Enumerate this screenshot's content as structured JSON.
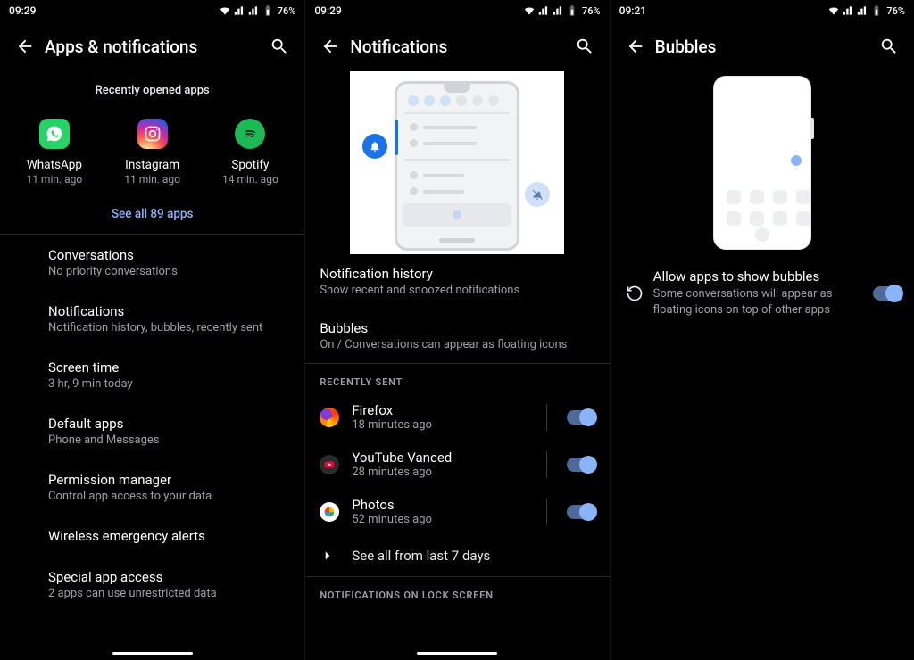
{
  "screen1": {
    "status": {
      "time": "09:29",
      "battery": "76%"
    },
    "header": {
      "title": "Apps & notifications"
    },
    "recently_opened_label": "Recently opened apps",
    "apps": [
      {
        "name": "WhatsApp",
        "sub": "11 min. ago"
      },
      {
        "name": "Instagram",
        "sub": "11 min. ago"
      },
      {
        "name": "Spotify",
        "sub": "14 min. ago"
      }
    ],
    "see_all": "See all 89 apps",
    "items": [
      {
        "title": "Conversations",
        "sub": "No priority conversations"
      },
      {
        "title": "Notifications",
        "sub": "Notification history, bubbles, recently sent"
      },
      {
        "title": "Screen time",
        "sub": "3 hr, 9 min today"
      },
      {
        "title": "Default apps",
        "sub": "Phone and Messages"
      },
      {
        "title": "Permission manager",
        "sub": "Control app access to your data"
      },
      {
        "title": "Wireless emergency alerts",
        "sub": ""
      },
      {
        "title": "Special app access",
        "sub": "2 apps can use unrestricted data"
      }
    ]
  },
  "screen2": {
    "status": {
      "time": "09:29",
      "battery": "76%"
    },
    "header": {
      "title": "Notifications"
    },
    "items_top": [
      {
        "title": "Notification history",
        "sub": "Show recent and snoozed notifications"
      },
      {
        "title": "Bubbles",
        "sub": "On / Conversations can appear as floating icons"
      }
    ],
    "recently_sent_label": "RECENTLY SENT",
    "recent": [
      {
        "name": "Firefox",
        "sub": "18 minutes ago"
      },
      {
        "name": "YouTube Vanced",
        "sub": "28 minutes ago"
      },
      {
        "name": "Photos",
        "sub": "52 minutes ago"
      }
    ],
    "see_all": "See all from last 7 days",
    "lock_section_label": "NOTIFICATIONS ON LOCK SCREEN"
  },
  "screen3": {
    "status": {
      "time": "09:21",
      "battery": "76%"
    },
    "header": {
      "title": "Bubbles"
    },
    "setting": {
      "title": "Allow apps to show bubbles",
      "sub": "Some conversations will appear as floating icons on top of other apps"
    }
  }
}
